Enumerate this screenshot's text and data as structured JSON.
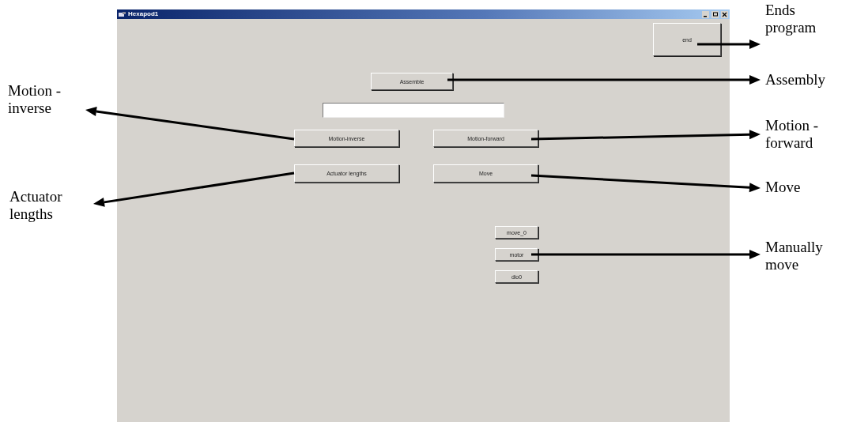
{
  "window": {
    "title": "Hexapod1"
  },
  "controls": [
    {
      "kind": "button",
      "label": "end"
    },
    {
      "kind": "button",
      "label": "Assemble"
    },
    {
      "kind": "text_field"
    },
    {
      "kind": "button",
      "label": "Motion-inverse"
    },
    {
      "kind": "button",
      "label": "Motion-forward"
    },
    {
      "kind": "button",
      "label": "Actuator lengths"
    },
    {
      "kind": "button",
      "label": "Move"
    },
    {
      "kind": "button",
      "label": "move_0"
    },
    {
      "kind": "button",
      "label": "motor"
    },
    {
      "kind": "button",
      "label": "dio0"
    }
  ],
  "annotations": [
    {
      "text": "Ends program"
    },
    {
      "text": "Assembly"
    },
    {
      "text": "Motion - inverse"
    },
    {
      "text": "Motion - forward"
    },
    {
      "text": "Actuator lengths"
    },
    {
      "text": "Move"
    },
    {
      "text": "Manually move"
    }
  ]
}
